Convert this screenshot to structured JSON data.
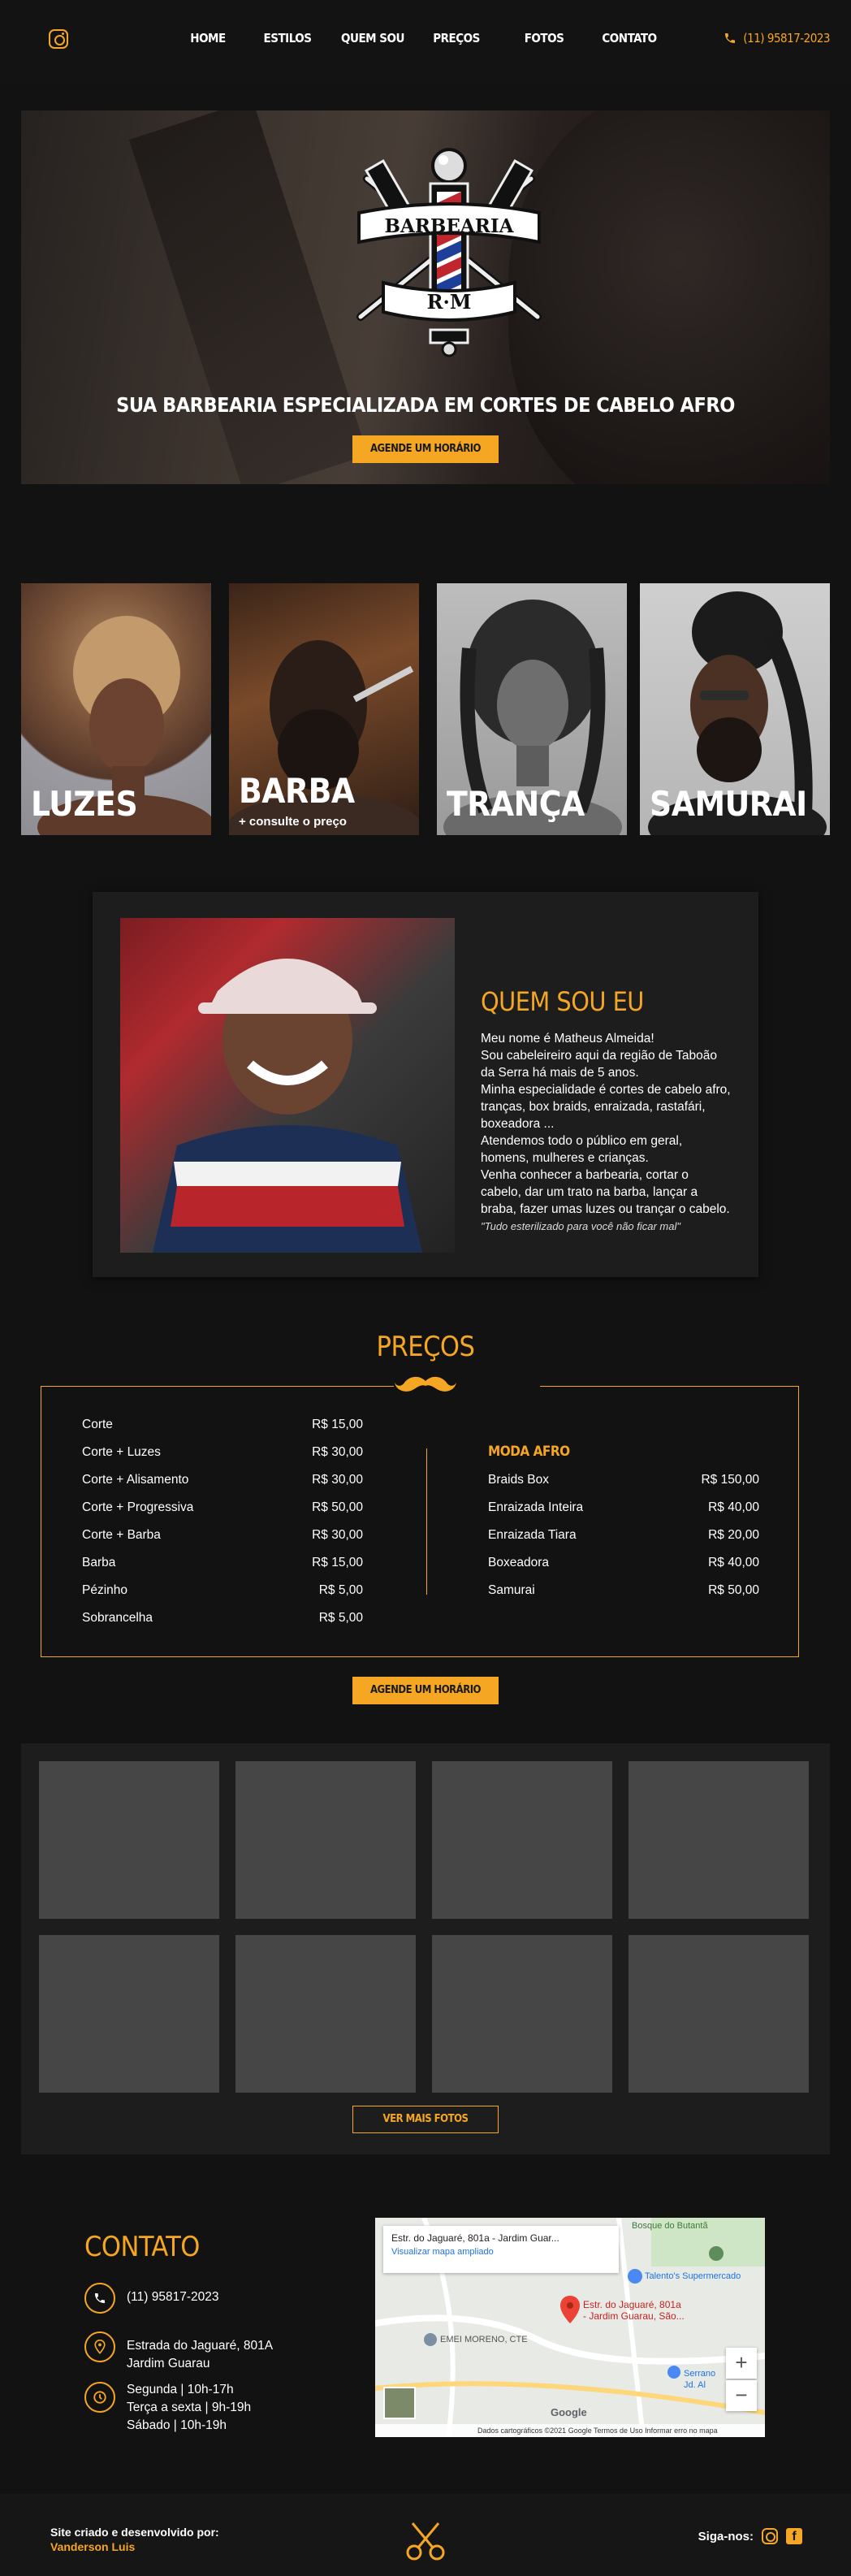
{
  "nav": {
    "items": [
      "HOME",
      "ESTILOS",
      "QUEM SOU",
      "PREÇOS",
      "FOTOS",
      "CONTATO"
    ],
    "phone": "(11) 95817-2023"
  },
  "hero": {
    "logo_top": "BARBEARIA",
    "logo_bottom": "R·M",
    "title": "SUA BARBEARIA ESPECIALIZADA EM CORTES DE CABELO AFRO",
    "cta": "AGENDE UM HORÁRIO"
  },
  "services": [
    {
      "label": "LUZES"
    },
    {
      "label": "BARBA",
      "sub": "+ consulte o preço"
    },
    {
      "label": "TRANÇA"
    },
    {
      "label": "SAMURAI"
    }
  ],
  "about": {
    "title": "QUEM SOU EU",
    "paragraphs": [
      " Meu nome é Matheus Almeida!",
      "Sou cabeleireiro aqui da região de Taboão da Serra há mais de 5 anos.",
      "Minha especialidade é cortes de cabelo afro, tranças, box braids, enraizada, rastafári, boxeadora ...",
      "Atendemos todo o público em geral, homens, mulheres e crianças.",
      "Venha conhecer a barbearia, cortar o cabelo, dar um trato na barba, lançar a braba, fazer umas luzes ou trançar o cabelo."
    ],
    "quote": "\"Tudo esterilizado para você não ficar mal\""
  },
  "prices": {
    "title": "PREÇOS",
    "left": [
      {
        "name": "Corte",
        "price": "R$ 15,00"
      },
      {
        "name": "Corte + Luzes",
        "price": "R$ 30,00"
      },
      {
        "name": "Corte + Alisamento",
        "price": "R$ 30,00"
      },
      {
        "name": "Corte + Progressiva",
        "price": "R$ 50,00"
      },
      {
        "name": "Corte + Barba",
        "price": "R$ 30,00"
      },
      {
        "name": "Barba",
        "price": "R$ 15,00"
      },
      {
        "name": "Pézinho",
        "price": "R$ 5,00"
      },
      {
        "name": "Sobrancelha",
        "price": "R$ 5,00"
      }
    ],
    "afro_title": "MODA AFRO",
    "right": [
      {
        "name": "Braids Box",
        "price": "R$ 150,00"
      },
      {
        "name": "Enraizada Inteira",
        "price": "R$ 40,00"
      },
      {
        "name": "Enraizada Tiara",
        "price": "R$ 20,00"
      },
      {
        "name": "Boxeadora",
        "price": "R$ 40,00"
      },
      {
        "name": "Samurai",
        "price": "R$ 50,00"
      }
    ],
    "cta": "AGENDE UM HORÁRIO"
  },
  "gallery": {
    "button": "VER MAIS FOTOS"
  },
  "contact": {
    "title": "CONTATO",
    "phone": "(11) 95817-2023",
    "address_line1": "Estrada do Jaguaré, 801A",
    "address_line2": "Jardim Guarau",
    "hours_line1": "Segunda | 10h-17h",
    "hours_line2": "Terça a sexta | 9h-19h",
    "hours_line3": "Sábado | 10h-19h"
  },
  "map": {
    "place": "Estr. do Jaguaré, 801a - Jardim Guar...",
    "link": "Visualizar mapa ampliado",
    "pin_label_1": "Estr. do Jaguaré, 801a",
    "pin_label_2": "- Jardim Guarau, São...",
    "poi_1": "Bosque do Butantã",
    "poi_2": "Talento's Supermercado",
    "poi_3": "EMEI MORENO, CTE",
    "poi_4": "Serrano",
    "poi_5": "Jd. Al",
    "footer": "Dados cartográficos ©2021 Google   Termos de Uso   Informar erro no mapa",
    "google": "Google"
  },
  "footer": {
    "credit_line": "Site criado e desenvolvido por:",
    "author": "Vanderson Luis",
    "follow": "Siga-nos:"
  },
  "colors": {
    "accent": "#f5a623",
    "background": "#121212",
    "panel": "#1d1d1d"
  }
}
